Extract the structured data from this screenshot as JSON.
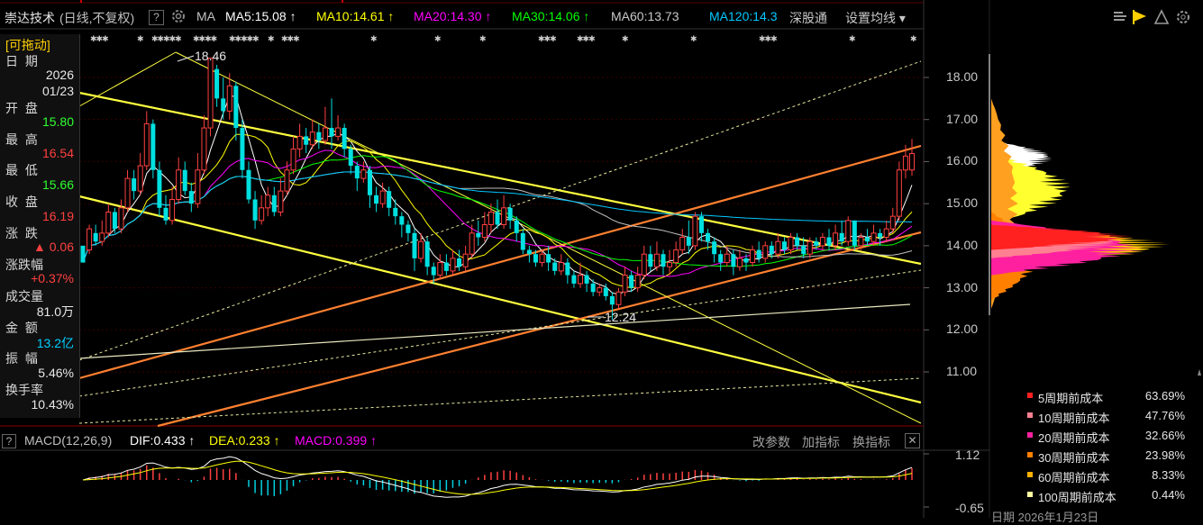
{
  "toolbar": {
    "stock_name": "崇达技术",
    "period_mode": "(日线,不复权)",
    "help_icon": "?",
    "ma_label": "MA",
    "ma5": "MA5:15.08",
    "ma10": "MA10:14.61",
    "ma20": "MA20:14.30",
    "ma30": "MA30:14.06",
    "ma60": "MA60:13.73",
    "ma120": "MA120:14.3",
    "market": "深股通",
    "set_ma": "设置均线",
    "colors": {
      "ma5": "#ffffff",
      "ma10": "#ffff00",
      "ma20": "#ff00ff",
      "ma30": "#00ff00",
      "ma60": "#c0c0c0",
      "ma120": "#00c8ff"
    }
  },
  "info_panel": {
    "draggable": "[可拖动]",
    "date_label": "日 期",
    "date_year": "2026",
    "date_md": "01/23",
    "open_label": "开 盘",
    "open": "15.80",
    "high_label": "最 高",
    "high": "16.54",
    "low_label": "最 低",
    "low": "15.66",
    "close_label": "收 盘",
    "close": "16.19",
    "change_label": "涨 跌",
    "change": "▲ 0.06",
    "change_pct_label": "涨跌幅",
    "change_pct": "+0.37%",
    "volume_label": "成交量",
    "volume": "81.0万",
    "amount_label": "金 额",
    "amount": "13.2亿",
    "amplitude_label": "振 幅",
    "amplitude": "5.46%",
    "turnover_label": "换手率",
    "turnover": "10.43%"
  },
  "price_axis": [
    "18.00",
    "17.00",
    "16.00",
    "15.00",
    "14.00",
    "13.00",
    "12.00",
    "11.00"
  ],
  "annotations": {
    "high_mark": "18.46",
    "low_mark": "12.24"
  },
  "cost_legend": [
    {
      "name": "5周期前成本",
      "pct": "63.69%",
      "color": "#ff2020"
    },
    {
      "name": "10周期前成本",
      "pct": "47.76%",
      "color": "#ff8090"
    },
    {
      "name": "20周期前成本",
      "pct": "32.66%",
      "color": "#ff20a0"
    },
    {
      "name": "30周期前成本",
      "pct": "23.98%",
      "color": "#ff8000"
    },
    {
      "name": "60周期前成本",
      "pct": "8.33%",
      "color": "#ffb000"
    },
    {
      "name": "100周期前成本",
      "pct": "0.44%",
      "color": "#ffffa0"
    }
  ],
  "macd_bar": {
    "help": "?",
    "title": "MACD(12,26,9)",
    "dif": "DIF:0.433",
    "dea": "DEA:0.233",
    "macd": "MACD:0.399",
    "modify": "改参数",
    "add": "加指标",
    "switch": "换指标",
    "close": "✕"
  },
  "macd_axis": [
    "1.12",
    "-0.65"
  ],
  "footer_partial": "日期    2026年1月23日",
  "chart_data": {
    "type": "candlestick",
    "y_range": [
      10.1,
      18.7
    ],
    "candles": [
      [
        14.0,
        13.6,
        13.8,
        14.0
      ],
      [
        13.9,
        14.4,
        13.8,
        14.5
      ],
      [
        14.3,
        14.1,
        14.0,
        14.5
      ],
      [
        14.1,
        14.3,
        14.0,
        14.6
      ],
      [
        14.3,
        14.8,
        14.2,
        15.0
      ],
      [
        14.8,
        14.4,
        14.3,
        14.9
      ],
      [
        14.4,
        14.9,
        14.3,
        15.1
      ],
      [
        14.9,
        15.6,
        14.8,
        15.8
      ],
      [
        15.6,
        15.3,
        15.1,
        15.8
      ],
      [
        15.3,
        15.9,
        15.2,
        16.2
      ],
      [
        15.9,
        16.9,
        15.8,
        17.2
      ],
      [
        16.9,
        15.8,
        15.6,
        17.0
      ],
      [
        15.8,
        14.9,
        14.7,
        16.0
      ],
      [
        14.9,
        14.6,
        14.5,
        15.2
      ],
      [
        14.6,
        15.1,
        14.5,
        15.4
      ],
      [
        15.1,
        15.8,
        15.0,
        16.1
      ],
      [
        15.8,
        15.3,
        15.2,
        16.0
      ],
      [
        15.3,
        15.0,
        14.8,
        15.5
      ],
      [
        15.0,
        15.8,
        14.9,
        16.2
      ],
      [
        15.8,
        16.8,
        15.7,
        17.1
      ],
      [
        16.8,
        18.46,
        16.6,
        18.46
      ],
      [
        18.2,
        17.5,
        17.3,
        18.3
      ],
      [
        17.5,
        17.2,
        17.0,
        18.0
      ],
      [
        17.2,
        17.8,
        17.0,
        18.1
      ],
      [
        17.8,
        16.8,
        16.5,
        17.9
      ],
      [
        16.8,
        15.8,
        15.6,
        17.0
      ],
      [
        15.8,
        15.1,
        15.0,
        16.0
      ],
      [
        15.1,
        14.6,
        14.4,
        15.3
      ],
      [
        14.6,
        14.9,
        14.5,
        15.2
      ],
      [
        14.9,
        15.2,
        14.7,
        15.4
      ],
      [
        15.2,
        14.8,
        14.7,
        15.4
      ],
      [
        14.8,
        15.3,
        14.7,
        15.6
      ],
      [
        15.3,
        15.8,
        15.2,
        16.0
      ],
      [
        15.8,
        16.3,
        15.7,
        16.6
      ],
      [
        16.3,
        16.6,
        16.1,
        16.9
      ],
      [
        16.6,
        16.4,
        16.2,
        16.8
      ],
      [
        16.4,
        16.7,
        16.3,
        17.0
      ],
      [
        16.7,
        16.5,
        16.3,
        16.9
      ],
      [
        16.5,
        16.8,
        16.4,
        17.3
      ],
      [
        16.8,
        16.6,
        16.3,
        17.5
      ],
      [
        16.6,
        16.8,
        16.5,
        17.1
      ],
      [
        16.8,
        16.3,
        16.1,
        16.9
      ],
      [
        16.3,
        15.9,
        15.7,
        16.4
      ],
      [
        15.9,
        15.6,
        15.3,
        16.0
      ],
      [
        15.6,
        15.8,
        15.5,
        16.0
      ],
      [
        15.8,
        15.2,
        14.9,
        15.9
      ],
      [
        15.2,
        15.0,
        14.8,
        15.4
      ],
      [
        15.0,
        15.3,
        14.9,
        15.5
      ],
      [
        15.3,
        14.9,
        14.7,
        15.4
      ],
      [
        14.9,
        14.7,
        14.5,
        15.1
      ],
      [
        14.7,
        14.5,
        14.2,
        14.8
      ],
      [
        14.5,
        14.3,
        14.1,
        14.6
      ],
      [
        14.3,
        13.7,
        13.4,
        14.4
      ],
      [
        13.7,
        14.1,
        13.6,
        14.3
      ],
      [
        14.1,
        13.5,
        13.3,
        14.2
      ],
      [
        13.5,
        13.3,
        13.1,
        13.6
      ],
      [
        13.3,
        13.6,
        13.2,
        13.8
      ],
      [
        13.6,
        13.4,
        13.3,
        13.8
      ],
      [
        13.4,
        13.7,
        13.3,
        13.9
      ],
      [
        13.7,
        13.5,
        13.4,
        13.9
      ],
      [
        13.5,
        13.8,
        13.4,
        14.0
      ],
      [
        13.8,
        14.3,
        13.7,
        14.5
      ],
      [
        14.3,
        14.2,
        14.0,
        14.6
      ],
      [
        14.2,
        14.5,
        14.1,
        14.8
      ],
      [
        14.5,
        14.8,
        14.3,
        15.0
      ],
      [
        14.8,
        14.5,
        14.4,
        15.1
      ],
      [
        14.5,
        14.9,
        14.4,
        15.2
      ],
      [
        14.9,
        14.6,
        14.4,
        15.0
      ],
      [
        14.6,
        14.3,
        14.1,
        14.7
      ],
      [
        14.3,
        13.9,
        13.8,
        14.4
      ],
      [
        13.9,
        13.8,
        13.6,
        14.0
      ],
      [
        13.8,
        13.6,
        13.5,
        13.9
      ],
      [
        13.6,
        13.8,
        13.5,
        13.9
      ],
      [
        13.8,
        13.6,
        13.4,
        14.0
      ],
      [
        13.6,
        13.4,
        13.3,
        13.7
      ],
      [
        13.4,
        13.6,
        13.3,
        13.8
      ],
      [
        13.6,
        13.3,
        13.1,
        13.7
      ],
      [
        13.3,
        13.1,
        13.0,
        13.4
      ],
      [
        13.1,
        13.3,
        13.0,
        13.6
      ],
      [
        13.3,
        13.1,
        12.9,
        13.4
      ],
      [
        13.1,
        12.9,
        12.8,
        13.2
      ],
      [
        12.9,
        13.0,
        12.8,
        13.1
      ],
      [
        13.0,
        12.8,
        12.7,
        13.1
      ],
      [
        12.8,
        12.6,
        12.24,
        12.9
      ],
      [
        12.6,
        12.9,
        12.5,
        13.0
      ],
      [
        12.9,
        13.3,
        12.8,
        13.5
      ],
      [
        13.3,
        13.0,
        12.9,
        13.4
      ],
      [
        13.0,
        13.3,
        12.9,
        13.5
      ],
      [
        13.3,
        13.8,
        13.2,
        14.0
      ],
      [
        13.8,
        13.5,
        13.4,
        14.0
      ],
      [
        13.5,
        13.8,
        13.4,
        14.1
      ],
      [
        13.8,
        13.5,
        13.3,
        13.9
      ],
      [
        13.5,
        13.6,
        13.3,
        13.9
      ],
      [
        13.6,
        13.9,
        13.5,
        14.1
      ],
      [
        13.9,
        14.2,
        13.8,
        14.4
      ],
      [
        14.2,
        14.0,
        13.8,
        14.6
      ],
      [
        14.0,
        14.7,
        13.9,
        14.8
      ],
      [
        14.7,
        14.3,
        14.1,
        14.8
      ],
      [
        14.3,
        14.1,
        13.9,
        14.4
      ],
      [
        14.1,
        13.8,
        13.6,
        14.2
      ],
      [
        13.8,
        13.6,
        13.4,
        13.9
      ],
      [
        13.6,
        13.8,
        13.5,
        14.0
      ],
      [
        13.8,
        13.5,
        13.3,
        13.9
      ],
      [
        13.5,
        13.7,
        13.4,
        13.9
      ],
      [
        13.7,
        13.6,
        13.4,
        13.8
      ],
      [
        13.6,
        13.9,
        13.5,
        14.0
      ],
      [
        13.9,
        13.7,
        13.6,
        14.1
      ],
      [
        13.7,
        14.0,
        13.6,
        14.1
      ],
      [
        14.0,
        13.8,
        13.7,
        14.1
      ],
      [
        13.8,
        14.1,
        13.7,
        14.3
      ],
      [
        14.1,
        13.9,
        13.8,
        14.2
      ],
      [
        13.9,
        14.2,
        13.8,
        14.3
      ],
      [
        14.2,
        14.0,
        13.9,
        14.3
      ],
      [
        14.0,
        13.8,
        13.7,
        14.2
      ],
      [
        13.8,
        14.1,
        13.7,
        14.2
      ],
      [
        14.1,
        14.0,
        13.9,
        14.2
      ],
      [
        14.0,
        14.2,
        13.9,
        14.3
      ],
      [
        14.2,
        14.0,
        13.9,
        14.4
      ],
      [
        14.0,
        14.3,
        13.9,
        14.5
      ],
      [
        14.3,
        14.1,
        14.0,
        14.6
      ],
      [
        14.1,
        14.6,
        14.0,
        14.7
      ],
      [
        14.6,
        14.0,
        13.9,
        14.6
      ],
      [
        14.0,
        14.2,
        13.9,
        14.3
      ],
      [
        14.2,
        14.1,
        14.0,
        14.4
      ],
      [
        14.1,
        14.3,
        14.0,
        14.5
      ],
      [
        14.3,
        14.2,
        14.0,
        14.4
      ],
      [
        14.2,
        14.4,
        14.1,
        14.6
      ],
      [
        14.4,
        14.7,
        14.3,
        14.9
      ],
      [
        14.7,
        15.8,
        14.6,
        16.0
      ],
      [
        15.8,
        16.13,
        15.6,
        16.4
      ],
      [
        15.8,
        16.19,
        15.66,
        16.54
      ]
    ],
    "macd_hist_range": [
      -0.65,
      1.12
    ]
  }
}
